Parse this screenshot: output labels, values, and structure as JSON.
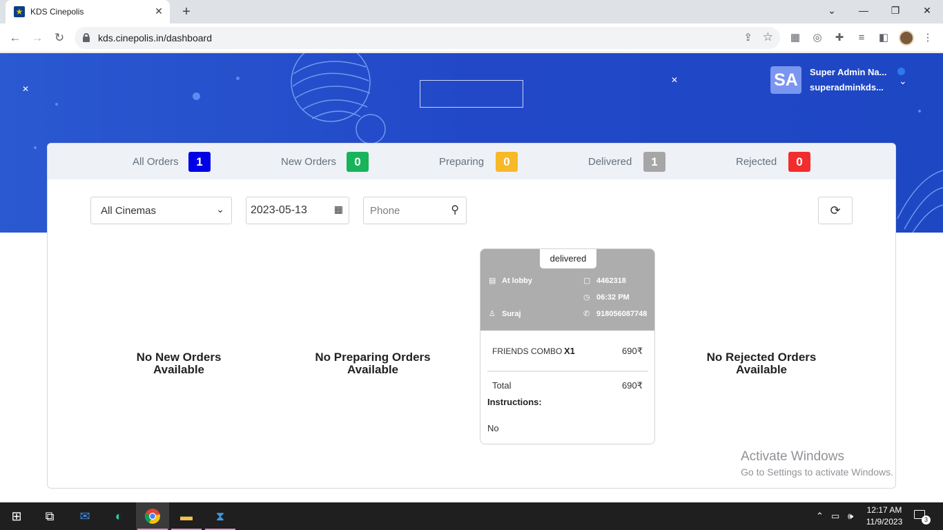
{
  "browser": {
    "tab_title": "KDS Cinepolis",
    "url": "kds.cinepolis.in/dashboard"
  },
  "header": {
    "user_initials": "SA",
    "user_name": "Super Admin Na...",
    "user_email": "superadminkds..."
  },
  "status": {
    "all_orders": {
      "label": "All Orders",
      "count": "1",
      "color": "#0000e6"
    },
    "new_orders": {
      "label": "New Orders",
      "count": "0",
      "color": "#17b45a"
    },
    "preparing": {
      "label": "Preparing",
      "count": "0",
      "color": "#f7b928"
    },
    "delivered": {
      "label": "Delivered",
      "count": "1",
      "color": "#a6a6a6"
    },
    "rejected": {
      "label": "Rejected",
      "count": "0",
      "color": "#f22d2d"
    }
  },
  "filters": {
    "cinema": "All Cinemas",
    "date": "2023-05-13",
    "phone_placeholder": "Phone"
  },
  "columns": {
    "new_empty": "No New Orders Available",
    "preparing_empty": "No Preparing Orders Available",
    "rejected_empty": "No Rejected Orders Available"
  },
  "order": {
    "status": "delivered",
    "location": "At lobby",
    "order_id": "4462318",
    "time": "06:32 PM",
    "customer": "Suraj",
    "phone": "918056087748",
    "item_name": "FRIENDS COMBO",
    "item_qty": "X1",
    "item_price": "690₹",
    "total_label": "Total",
    "total_value": "690₹",
    "instructions_label": "Instructions:",
    "instructions_value": "No"
  },
  "watermark": {
    "line1": "Activate Windows",
    "line2": "Go to Settings to activate Windows."
  },
  "taskbar": {
    "time": "12:17 AM",
    "date": "11/9/2023",
    "notifications": "3"
  }
}
